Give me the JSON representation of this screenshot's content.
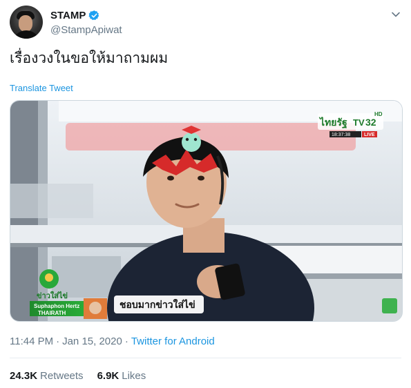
{
  "user": {
    "display_name": "STAMP",
    "handle": "@StampApiwat",
    "verified": true
  },
  "tweet": {
    "text": "เรื่องวงในขอให้มาถามผม",
    "translate_label": "Translate Tweet"
  },
  "media": {
    "channel_logo_text": "ไทยรัฐ",
    "channel_tv_text": "TV",
    "channel_number": "32",
    "channel_hd": "HD",
    "clock": "18:37:38",
    "live_label": "LIVE",
    "program_logo_text": "ข่าวใส่ไข่",
    "presenter_name": "Suphaphon Hertz",
    "station_label": "THAIRATH",
    "caption": "ชอบมากข่าวใส่ไข่"
  },
  "meta": {
    "time": "11:44 PM",
    "separator1": "·",
    "date": "Jan 15, 2020",
    "separator2": "·",
    "source": "Twitter for Android"
  },
  "stats": {
    "retweets_count": "24.3K",
    "retweets_label": "Retweets",
    "likes_count": "6.9K",
    "likes_label": "Likes"
  },
  "colors": {
    "link": "#1b95e0",
    "verified": "#1da1f2",
    "secondary_text": "#657786"
  }
}
